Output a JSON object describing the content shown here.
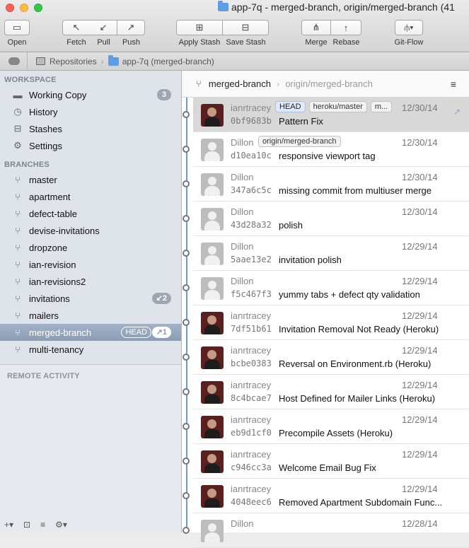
{
  "window": {
    "title": "app-7q - merged-branch, origin/merged-branch (41"
  },
  "toolbar": {
    "open": "Open",
    "fetch": "Fetch",
    "pull": "Pull",
    "push": "Push",
    "apply_stash": "Apply Stash",
    "save_stash": "Save Stash",
    "merge": "Merge",
    "rebase": "Rebase",
    "gitflow": "Git-Flow"
  },
  "pathbar": {
    "repositories": "Repositories",
    "current": "app-7q (merged-branch)"
  },
  "sidebar": {
    "workspace_title": "WORKSPACE",
    "workspace": [
      {
        "label": "Working Copy",
        "icon": "folder-icon",
        "badge": "3"
      },
      {
        "label": "History",
        "icon": "clock-icon"
      },
      {
        "label": "Stashes",
        "icon": "stash-icon"
      },
      {
        "label": "Settings",
        "icon": "gear-icon"
      }
    ],
    "branches_title": "BRANCHES",
    "branches": [
      {
        "label": "master"
      },
      {
        "label": "apartment"
      },
      {
        "label": "defect-table"
      },
      {
        "label": "devise-invitations"
      },
      {
        "label": "dropzone"
      },
      {
        "label": "ian-revision"
      },
      {
        "label": "ian-revisions2"
      },
      {
        "label": "invitations",
        "badge": "↙2"
      },
      {
        "label": "mailers"
      },
      {
        "label": "merged-branch",
        "head": "HEAD",
        "ahead": "↗1"
      },
      {
        "label": "multi-tenancy"
      }
    ],
    "remote_title": "REMOTE ACTIVITY"
  },
  "main": {
    "branch": "merged-branch",
    "upstream": "origin/merged-branch",
    "commits": [
      {
        "author": "ianrtracey",
        "sha": "0bf9683b",
        "message": "Pattern Fix",
        "date": "12/30/14",
        "avatar": "photo",
        "tags": [
          "HEAD",
          "heroku/master",
          "m..."
        ]
      },
      {
        "author": "Dillon",
        "sha": "d10ea10c",
        "message": "responsive viewport tag",
        "date": "12/30/14",
        "avatar": "ghost",
        "tags": [
          "origin/merged-branch"
        ]
      },
      {
        "author": "Dillon",
        "sha": "347a6c5c",
        "message": "missing commit from multiuser merge",
        "date": "12/30/14",
        "avatar": "ghost",
        "tags": []
      },
      {
        "author": "Dillon",
        "sha": "43d28a32",
        "message": "polish",
        "date": "12/30/14",
        "avatar": "ghost",
        "tags": []
      },
      {
        "author": "Dillon",
        "sha": "5aae13e2",
        "message": "invitation polish",
        "date": "12/29/14",
        "avatar": "ghost",
        "tags": []
      },
      {
        "author": "Dillon",
        "sha": "f5c467f3",
        "message": "yummy tabs + defect qty validation",
        "date": "12/29/14",
        "avatar": "ghost",
        "tags": []
      },
      {
        "author": "ianrtracey",
        "sha": "7df51b61",
        "message": "Invitation Removal Not Ready (Heroku)",
        "date": "12/29/14",
        "avatar": "photo",
        "tags": []
      },
      {
        "author": "ianrtracey",
        "sha": "bcbe0383",
        "message": "Reversal on Environment.rb (Heroku)",
        "date": "12/29/14",
        "avatar": "photo",
        "tags": []
      },
      {
        "author": "ianrtracey",
        "sha": "8c4bcae7",
        "message": "Host Defined for Mailer Links (Heroku)",
        "date": "12/29/14",
        "avatar": "photo",
        "tags": []
      },
      {
        "author": "ianrtracey",
        "sha": "eb9d1cf0",
        "message": "Precompile Assets (Heroku)",
        "date": "12/29/14",
        "avatar": "photo",
        "tags": []
      },
      {
        "author": "ianrtracey",
        "sha": "c946cc3a",
        "message": "Welcome Email Bug Fix",
        "date": "12/29/14",
        "avatar": "photo",
        "tags": []
      },
      {
        "author": "ianrtracey",
        "sha": "4048eec6",
        "message": "Removed Apartment Subdomain Func...",
        "date": "12/29/14",
        "avatar": "photo",
        "tags": []
      },
      {
        "author": "Dillon",
        "sha": "",
        "message": "",
        "date": "12/28/14",
        "avatar": "ghost",
        "tags": []
      }
    ]
  }
}
